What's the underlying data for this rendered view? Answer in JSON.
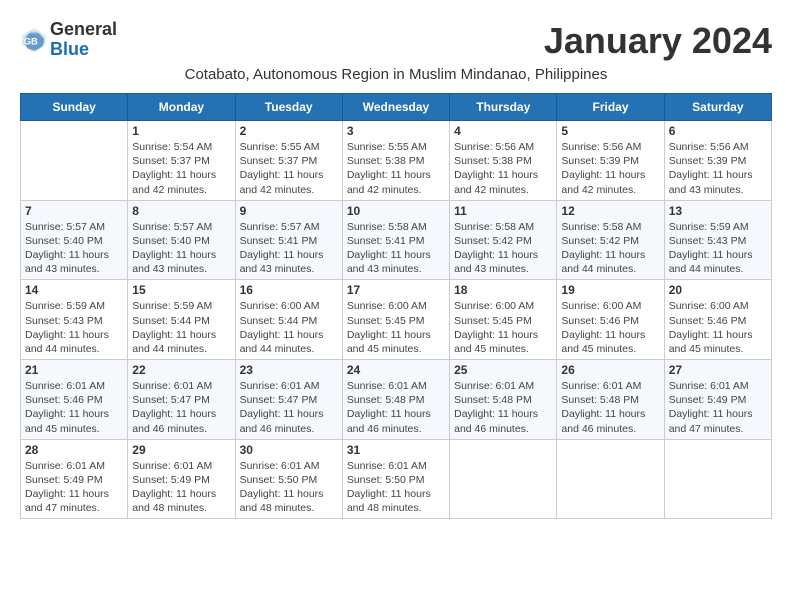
{
  "header": {
    "logo_general": "General",
    "logo_blue": "Blue",
    "month_title": "January 2024",
    "subtitle": "Cotabato, Autonomous Region in Muslim Mindanao, Philippines"
  },
  "calendar": {
    "days_of_week": [
      "Sunday",
      "Monday",
      "Tuesday",
      "Wednesday",
      "Thursday",
      "Friday",
      "Saturday"
    ],
    "weeks": [
      [
        {
          "day": "",
          "info": ""
        },
        {
          "day": "1",
          "info": "Sunrise: 5:54 AM\nSunset: 5:37 PM\nDaylight: 11 hours\nand 42 minutes."
        },
        {
          "day": "2",
          "info": "Sunrise: 5:55 AM\nSunset: 5:37 PM\nDaylight: 11 hours\nand 42 minutes."
        },
        {
          "day": "3",
          "info": "Sunrise: 5:55 AM\nSunset: 5:38 PM\nDaylight: 11 hours\nand 42 minutes."
        },
        {
          "day": "4",
          "info": "Sunrise: 5:56 AM\nSunset: 5:38 PM\nDaylight: 11 hours\nand 42 minutes."
        },
        {
          "day": "5",
          "info": "Sunrise: 5:56 AM\nSunset: 5:39 PM\nDaylight: 11 hours\nand 42 minutes."
        },
        {
          "day": "6",
          "info": "Sunrise: 5:56 AM\nSunset: 5:39 PM\nDaylight: 11 hours\nand 43 minutes."
        }
      ],
      [
        {
          "day": "7",
          "info": "Sunrise: 5:57 AM\nSunset: 5:40 PM\nDaylight: 11 hours\nand 43 minutes."
        },
        {
          "day": "8",
          "info": "Sunrise: 5:57 AM\nSunset: 5:40 PM\nDaylight: 11 hours\nand 43 minutes."
        },
        {
          "day": "9",
          "info": "Sunrise: 5:57 AM\nSunset: 5:41 PM\nDaylight: 11 hours\nand 43 minutes."
        },
        {
          "day": "10",
          "info": "Sunrise: 5:58 AM\nSunset: 5:41 PM\nDaylight: 11 hours\nand 43 minutes."
        },
        {
          "day": "11",
          "info": "Sunrise: 5:58 AM\nSunset: 5:42 PM\nDaylight: 11 hours\nand 43 minutes."
        },
        {
          "day": "12",
          "info": "Sunrise: 5:58 AM\nSunset: 5:42 PM\nDaylight: 11 hours\nand 44 minutes."
        },
        {
          "day": "13",
          "info": "Sunrise: 5:59 AM\nSunset: 5:43 PM\nDaylight: 11 hours\nand 44 minutes."
        }
      ],
      [
        {
          "day": "14",
          "info": "Sunrise: 5:59 AM\nSunset: 5:43 PM\nDaylight: 11 hours\nand 44 minutes."
        },
        {
          "day": "15",
          "info": "Sunrise: 5:59 AM\nSunset: 5:44 PM\nDaylight: 11 hours\nand 44 minutes."
        },
        {
          "day": "16",
          "info": "Sunrise: 6:00 AM\nSunset: 5:44 PM\nDaylight: 11 hours\nand 44 minutes."
        },
        {
          "day": "17",
          "info": "Sunrise: 6:00 AM\nSunset: 5:45 PM\nDaylight: 11 hours\nand 45 minutes."
        },
        {
          "day": "18",
          "info": "Sunrise: 6:00 AM\nSunset: 5:45 PM\nDaylight: 11 hours\nand 45 minutes."
        },
        {
          "day": "19",
          "info": "Sunrise: 6:00 AM\nSunset: 5:46 PM\nDaylight: 11 hours\nand 45 minutes."
        },
        {
          "day": "20",
          "info": "Sunrise: 6:00 AM\nSunset: 5:46 PM\nDaylight: 11 hours\nand 45 minutes."
        }
      ],
      [
        {
          "day": "21",
          "info": "Sunrise: 6:01 AM\nSunset: 5:46 PM\nDaylight: 11 hours\nand 45 minutes."
        },
        {
          "day": "22",
          "info": "Sunrise: 6:01 AM\nSunset: 5:47 PM\nDaylight: 11 hours\nand 46 minutes."
        },
        {
          "day": "23",
          "info": "Sunrise: 6:01 AM\nSunset: 5:47 PM\nDaylight: 11 hours\nand 46 minutes."
        },
        {
          "day": "24",
          "info": "Sunrise: 6:01 AM\nSunset: 5:48 PM\nDaylight: 11 hours\nand 46 minutes."
        },
        {
          "day": "25",
          "info": "Sunrise: 6:01 AM\nSunset: 5:48 PM\nDaylight: 11 hours\nand 46 minutes."
        },
        {
          "day": "26",
          "info": "Sunrise: 6:01 AM\nSunset: 5:48 PM\nDaylight: 11 hours\nand 46 minutes."
        },
        {
          "day": "27",
          "info": "Sunrise: 6:01 AM\nSunset: 5:49 PM\nDaylight: 11 hours\nand 47 minutes."
        }
      ],
      [
        {
          "day": "28",
          "info": "Sunrise: 6:01 AM\nSunset: 5:49 PM\nDaylight: 11 hours\nand 47 minutes."
        },
        {
          "day": "29",
          "info": "Sunrise: 6:01 AM\nSunset: 5:49 PM\nDaylight: 11 hours\nand 48 minutes."
        },
        {
          "day": "30",
          "info": "Sunrise: 6:01 AM\nSunset: 5:50 PM\nDaylight: 11 hours\nand 48 minutes."
        },
        {
          "day": "31",
          "info": "Sunrise: 6:01 AM\nSunset: 5:50 PM\nDaylight: 11 hours\nand 48 minutes."
        },
        {
          "day": "",
          "info": ""
        },
        {
          "day": "",
          "info": ""
        },
        {
          "day": "",
          "info": ""
        }
      ]
    ]
  }
}
